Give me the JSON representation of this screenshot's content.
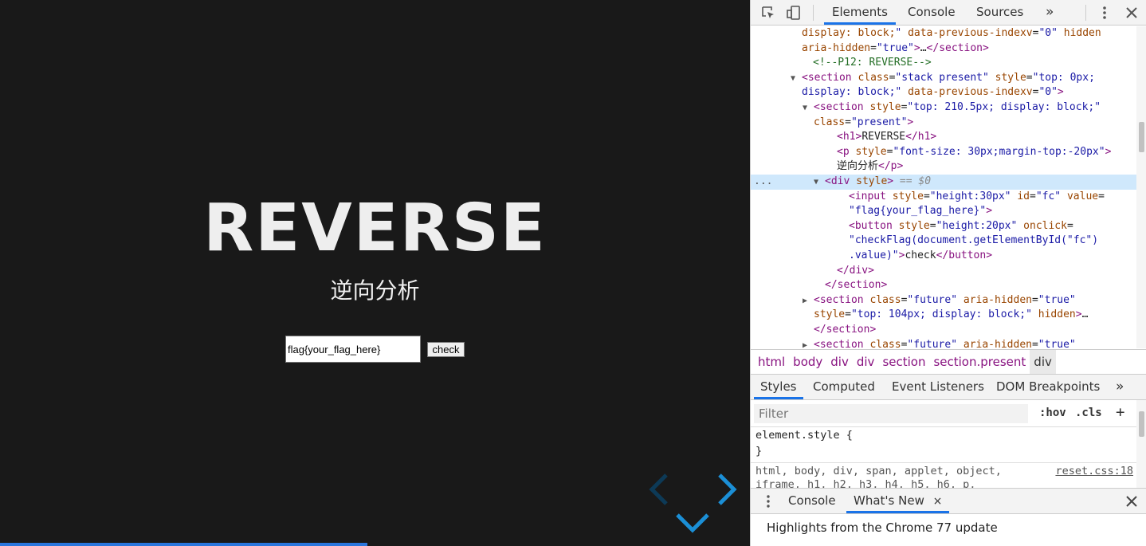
{
  "slide": {
    "title": "REVERSE",
    "subtitle": "逆向分析",
    "input_value": "flag{your_flag_here}",
    "button_label": "check",
    "progress": 0.49,
    "nav_icons": [
      "chevron-left-icon",
      "chevron-right-icon",
      "chevron-down-icon"
    ]
  },
  "devtools": {
    "tabs": [
      "Elements",
      "Console",
      "Sources"
    ],
    "more": "»",
    "dom_lines": [
      {
        "indent": 64,
        "parts": [
          [
            "an",
            "display: block;"
          ],
          [
            "av",
            "\""
          ],
          [
            "tx",
            " "
          ],
          [
            "an",
            "data-previous-indexv"
          ],
          [
            "tx",
            "="
          ],
          [
            "av",
            "\"0\""
          ],
          [
            "tx",
            " "
          ],
          [
            "an",
            "hidden"
          ]
        ]
      },
      {
        "indent": 64,
        "parts": [
          [
            "an",
            "aria-hidden"
          ],
          [
            "tx",
            "="
          ],
          [
            "av",
            "\"true\""
          ],
          [
            "tag",
            ">"
          ],
          [
            "tx",
            "…"
          ],
          [
            "tag",
            "</section>"
          ]
        ]
      },
      {
        "indent": 78,
        "parts": [
          [
            "cm",
            "<!--P12: REVERSE-->"
          ]
        ]
      },
      {
        "indent": 64,
        "tri": "▼",
        "parts": [
          [
            "tag",
            "<section "
          ],
          [
            "an",
            "class"
          ],
          [
            "tx",
            "="
          ],
          [
            "av",
            "\"stack present\""
          ],
          [
            "tx",
            " "
          ],
          [
            "an",
            "style"
          ],
          [
            "tx",
            "="
          ],
          [
            "av",
            "\"top: 0px;"
          ]
        ]
      },
      {
        "indent": 64,
        "parts": [
          [
            "av",
            "display: block;\""
          ],
          [
            "tx",
            " "
          ],
          [
            "an",
            "data-previous-indexv"
          ],
          [
            "tx",
            "="
          ],
          [
            "av",
            "\"0\""
          ],
          [
            "tag",
            ">"
          ]
        ]
      },
      {
        "indent": 79,
        "tri": "▼",
        "parts": [
          [
            "tag",
            "<section "
          ],
          [
            "an",
            "style"
          ],
          [
            "tx",
            "="
          ],
          [
            "av",
            "\"top: 210.5px; display: block;\""
          ]
        ]
      },
      {
        "indent": 79,
        "parts": [
          [
            "an",
            "class"
          ],
          [
            "tx",
            "="
          ],
          [
            "av",
            "\"present\""
          ],
          [
            "tag",
            ">"
          ]
        ]
      },
      {
        "indent": 108,
        "parts": [
          [
            "tag",
            "<h1>"
          ],
          [
            "tx",
            "REVERSE"
          ],
          [
            "tag",
            "</h1>"
          ]
        ]
      },
      {
        "indent": 108,
        "parts": [
          [
            "tag",
            "<p "
          ],
          [
            "an",
            "style"
          ],
          [
            "tx",
            "="
          ],
          [
            "av",
            "\"font-size: 30px;margin-top:-20px\""
          ],
          [
            "tag",
            ">"
          ]
        ]
      },
      {
        "indent": 108,
        "parts": [
          [
            "tx",
            "逆向分析"
          ],
          [
            "tag",
            "</p>"
          ]
        ]
      },
      {
        "indent": 93,
        "tri": "▼",
        "sel": true,
        "parts": [
          [
            "tag",
            "<div "
          ],
          [
            "an",
            "style"
          ],
          [
            "tag",
            ">"
          ],
          [
            "eq",
            " == $0"
          ]
        ]
      },
      {
        "indent": 123,
        "parts": [
          [
            "tag",
            "<input "
          ],
          [
            "an",
            "style"
          ],
          [
            "tx",
            "="
          ],
          [
            "av",
            "\"height:30px\""
          ],
          [
            "tx",
            " "
          ],
          [
            "an",
            "id"
          ],
          [
            "tx",
            "="
          ],
          [
            "av",
            "\"fc\""
          ],
          [
            "tx",
            " "
          ],
          [
            "an",
            "value"
          ],
          [
            "tx",
            "="
          ]
        ]
      },
      {
        "indent": 123,
        "parts": [
          [
            "av",
            "\"flag{your_flag_here}\""
          ],
          [
            "tag",
            ">"
          ]
        ]
      },
      {
        "indent": 123,
        "parts": [
          [
            "tag",
            "<button "
          ],
          [
            "an",
            "style"
          ],
          [
            "tx",
            "="
          ],
          [
            "av",
            "\"height:20px\""
          ],
          [
            "tx",
            " "
          ],
          [
            "an",
            "onclick"
          ],
          [
            "tx",
            "="
          ]
        ]
      },
      {
        "indent": 123,
        "parts": [
          [
            "av",
            "\"checkFlag(document.getElementById(\"fc\")"
          ]
        ]
      },
      {
        "indent": 123,
        "parts": [
          [
            "av",
            ".value)\""
          ],
          [
            "tag",
            ">"
          ],
          [
            "tx",
            "check"
          ],
          [
            "tag",
            "</button>"
          ]
        ]
      },
      {
        "indent": 108,
        "parts": [
          [
            "tag",
            "</div>"
          ]
        ]
      },
      {
        "indent": 93,
        "parts": [
          [
            "tag",
            "</section>"
          ]
        ]
      },
      {
        "indent": 79,
        "tri": "▶",
        "parts": [
          [
            "tag",
            "<section "
          ],
          [
            "an",
            "class"
          ],
          [
            "tx",
            "="
          ],
          [
            "av",
            "\"future\""
          ],
          [
            "tx",
            " "
          ],
          [
            "an",
            "aria-hidden"
          ],
          [
            "tx",
            "="
          ],
          [
            "av",
            "\"true\""
          ]
        ]
      },
      {
        "indent": 79,
        "parts": [
          [
            "an",
            "style"
          ],
          [
            "tx",
            "="
          ],
          [
            "av",
            "\"top: 104px; display: block;\""
          ],
          [
            "tx",
            " "
          ],
          [
            "an",
            "hidden"
          ],
          [
            "tag",
            ">"
          ],
          [
            "tx",
            "…"
          ]
        ]
      },
      {
        "indent": 79,
        "parts": [
          [
            "tag",
            "</section>"
          ]
        ]
      },
      {
        "indent": 79,
        "tri": "▶",
        "parts": [
          [
            "tag",
            "<section "
          ],
          [
            "an",
            "class"
          ],
          [
            "tx",
            "="
          ],
          [
            "av",
            "\"future\""
          ],
          [
            "tx",
            " "
          ],
          [
            "an",
            "aria-hidden"
          ],
          [
            "tx",
            "="
          ],
          [
            "av",
            "\"true\""
          ]
        ]
      }
    ],
    "breadcrumbs": [
      {
        "tag": "html",
        "cls": ""
      },
      {
        "tag": "body",
        "cls": ""
      },
      {
        "tag": "div",
        "cls": ""
      },
      {
        "tag": "div",
        "cls": ""
      },
      {
        "tag": "section",
        "cls": ""
      },
      {
        "tag": "section",
        "cls": ".present"
      },
      {
        "tag": "div",
        "cls": "",
        "current": true
      }
    ],
    "styles_tabs": [
      "Styles",
      "Computed",
      "Event Listeners",
      "DOM Breakpoints"
    ],
    "filter_placeholder": "Filter",
    "hov": ":hov",
    "cls": ".cls",
    "plus": "+",
    "element_style_open": "element.style {",
    "element_style_close": "}",
    "rule_selector_1": "html, body, div, span, applet, object,",
    "rule_selector_2": "iframe, h1, h2, h3, h4, h5, h6, p,",
    "rule_link": "reset.css:18",
    "drawer_tabs": [
      "Console",
      "What's New"
    ],
    "drawer_close_x": "×",
    "drawer_message": "Highlights from the Chrome 77 update",
    "colors": {
      "accent": "#1a73e8",
      "selection": "#cfe8fc",
      "slide_bg": "#191919",
      "progress": "#2a76dd"
    }
  }
}
